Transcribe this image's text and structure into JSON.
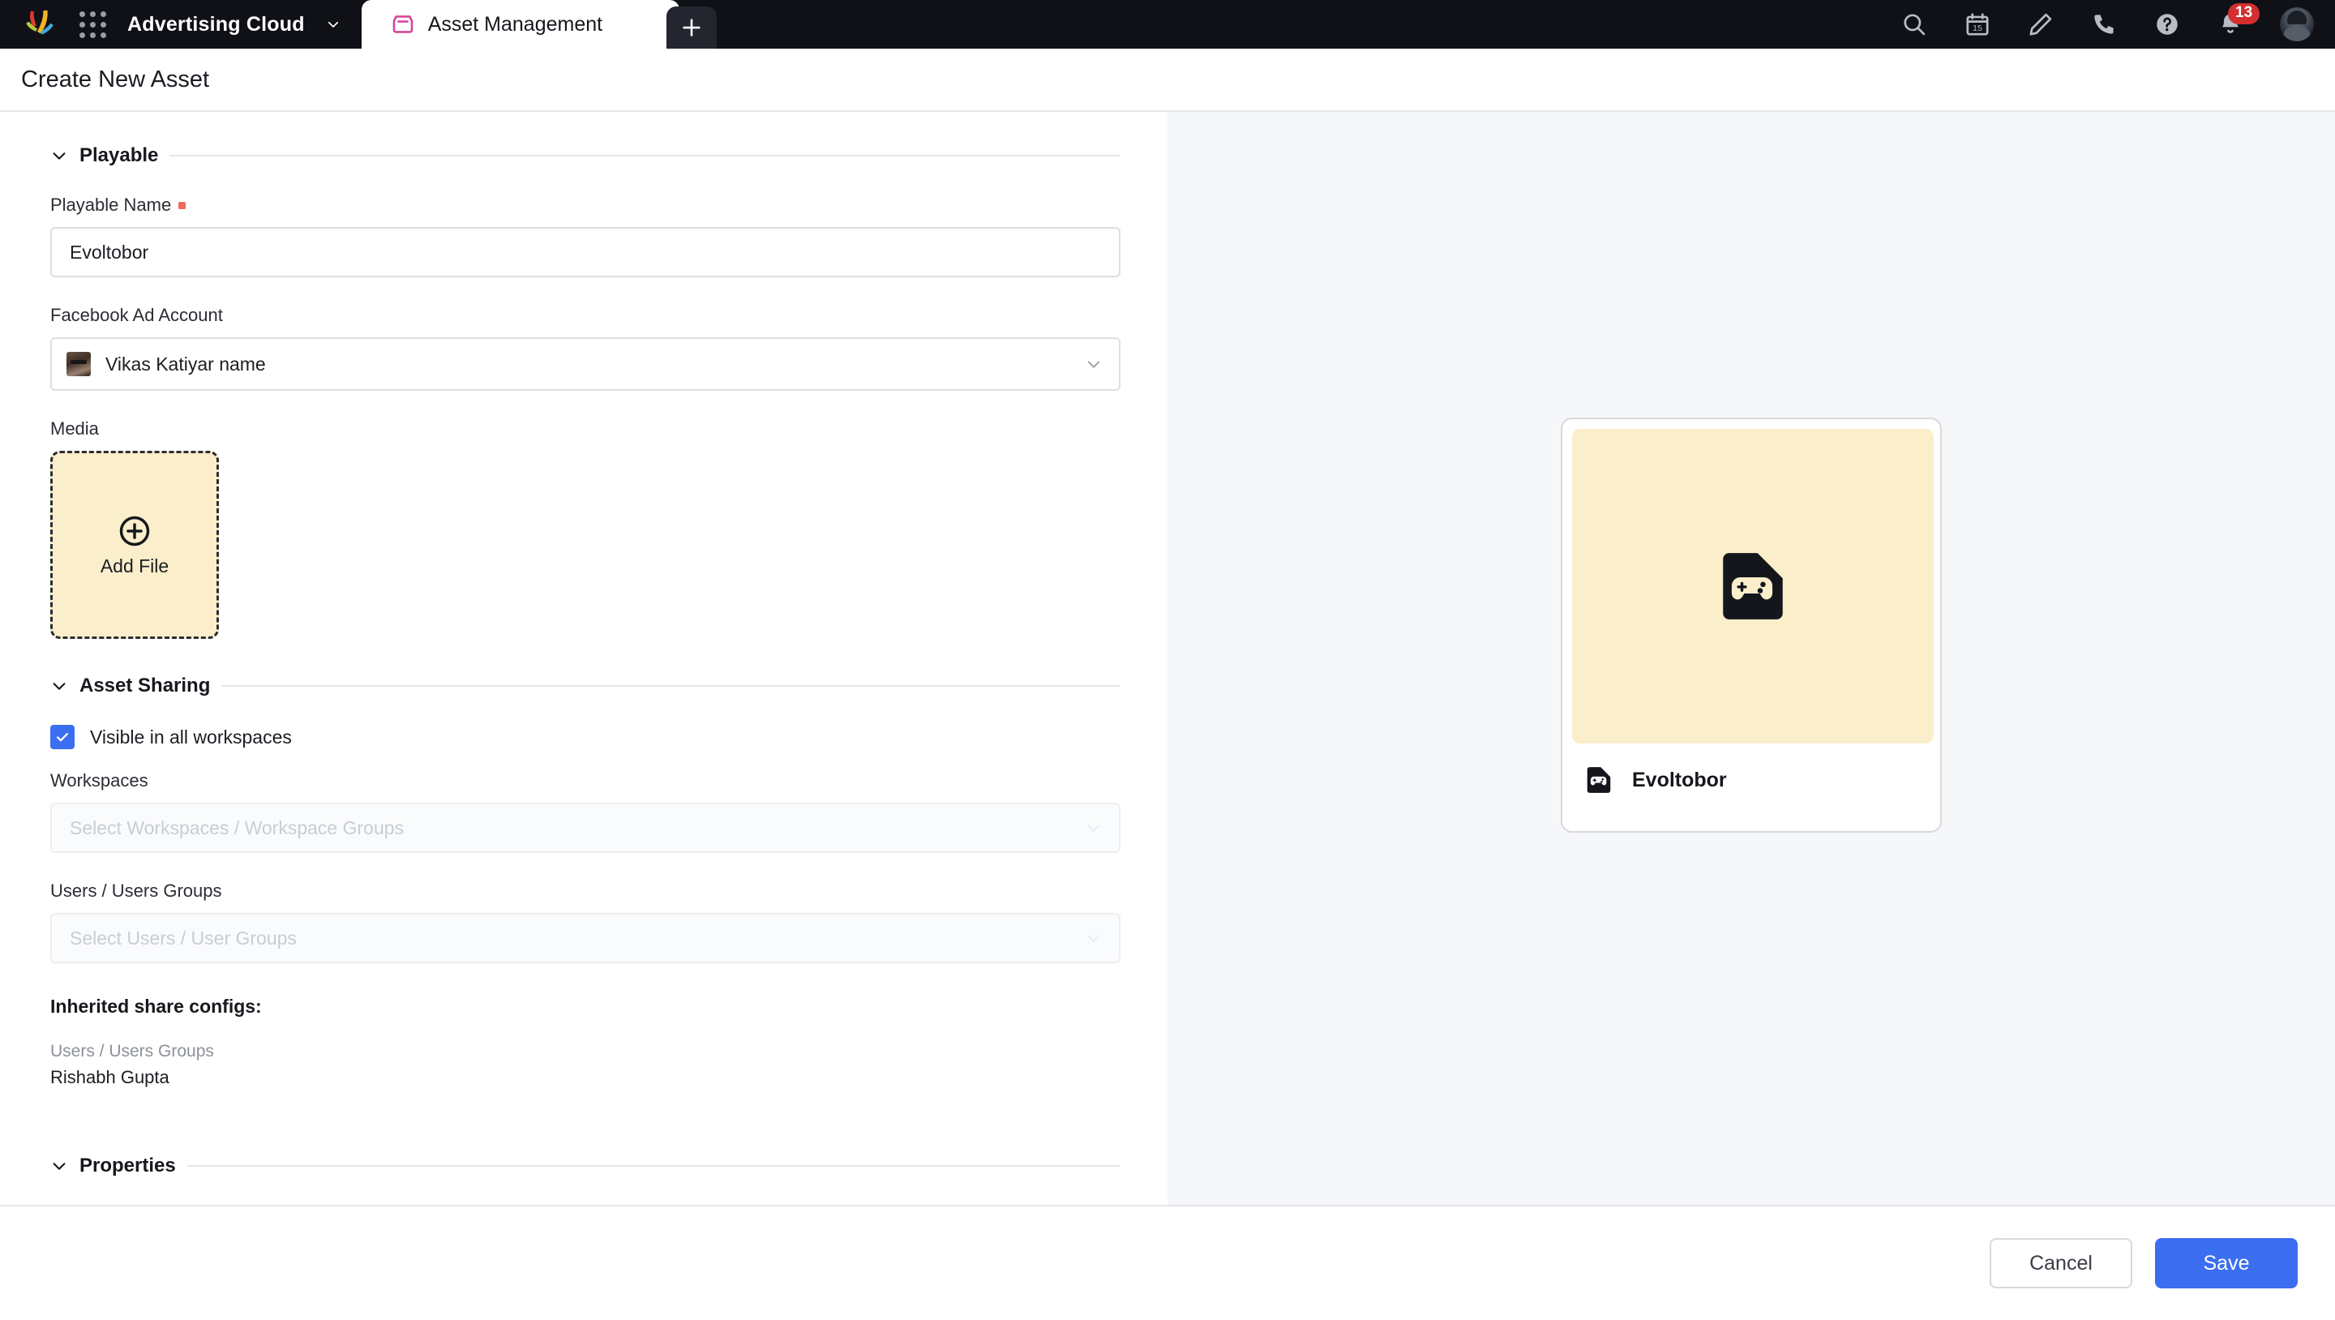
{
  "topbar": {
    "logo_icon": "splash-logo",
    "app_switcher_icon": "app-grid-icon",
    "app_name": "Advertising Cloud",
    "app_chevron_icon": "chevron-down-icon",
    "tabs": [
      {
        "label": "Asset Management",
        "icon": "inbox-icon",
        "active": true
      }
    ],
    "new_tab_icon": "plus-icon",
    "actions": [
      {
        "name": "search-icon",
        "label": "Search"
      },
      {
        "name": "calendar-icon",
        "label": "Calendar",
        "day": "15"
      },
      {
        "name": "pencil-icon",
        "label": "Compose"
      },
      {
        "name": "phone-icon",
        "label": "Call"
      },
      {
        "name": "help-icon",
        "label": "Help"
      }
    ],
    "notifications": {
      "icon": "bell-icon",
      "count": "13"
    },
    "avatar": {
      "name": "user-avatar"
    }
  },
  "header": {
    "title": "Create New Asset"
  },
  "sections": {
    "playable": {
      "title": "Playable",
      "chevron_icon": "chevron-down-icon",
      "name_field": {
        "label": "Playable Name",
        "required": true,
        "value": "Evoltobor",
        "placeholder": ""
      },
      "ad_account_field": {
        "label": "Facebook Ad Account",
        "value": "Vikas Katiyar name",
        "chevron_icon": "chevron-down-icon",
        "avatar_icon": "account-avatar"
      },
      "media_field": {
        "label": "Media",
        "add_file_label": "Add File",
        "add_icon": "plus-circle-icon"
      }
    },
    "asset_sharing": {
      "title": "Asset Sharing",
      "chevron_icon": "chevron-down-icon",
      "visible_all": {
        "label": "Visible in all workspaces",
        "checked": true,
        "check_icon": "checkmark-icon"
      },
      "workspaces": {
        "label": "Workspaces",
        "placeholder": "Select Workspaces / Workspace Groups",
        "value": "",
        "chevron_icon": "chevron-down-icon"
      },
      "users_groups": {
        "label": "Users / Users Groups",
        "placeholder": "Select Users / User Groups",
        "value": "",
        "chevron_icon": "chevron-down-icon"
      },
      "inherited": {
        "title": "Inherited share configs:",
        "rows": [
          {
            "label": "Users / Users Groups",
            "value": "Rishabh Gupta"
          }
        ]
      }
    },
    "properties": {
      "title": "Properties",
      "chevron_icon": "chevron-down-icon"
    }
  },
  "preview": {
    "name": "Evoltobor",
    "thumb_icon": "game-file-icon",
    "badge_icon": "game-file-icon",
    "thumb_bg": "#fbeecb"
  },
  "footer": {
    "cancel_label": "Cancel",
    "save_label": "Save"
  },
  "colors": {
    "accent_blue": "#3b6ef0",
    "topbar_dark": "#0f1117",
    "tab_accent_pink": "#d8479b",
    "media_cream": "#fbeecb",
    "required_red": "#ef6b5a",
    "badge_red": "#d32f2f",
    "right_pane_bg": "#f6f7f9"
  }
}
